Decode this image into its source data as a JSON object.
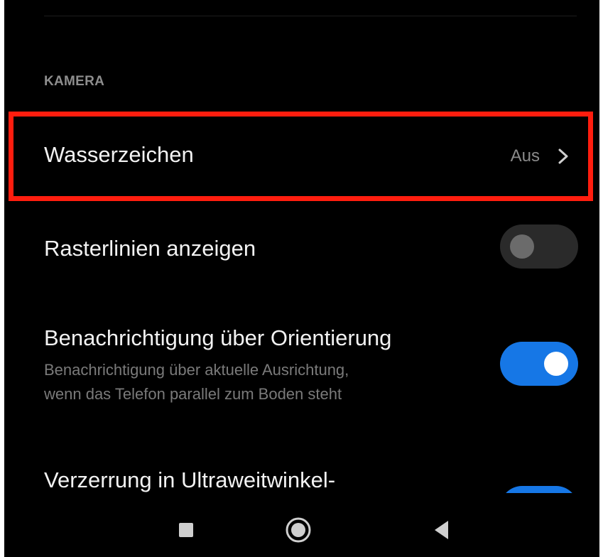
{
  "section": {
    "title": "KAMERA"
  },
  "settings": {
    "watermark": {
      "title": "Wasserzeichen",
      "value": "Aus"
    },
    "gridlines": {
      "title": "Rasterlinien anzeigen",
      "enabled": false
    },
    "orientation": {
      "title": "Benachrichtigung über Orientierung",
      "description_line1": "Benachrichtigung über aktuelle Ausrichtung,",
      "description_line2": "wenn das Telefon parallel zum Boden steht",
      "enabled": true
    },
    "distortion": {
      "title": "Verzerrung in Ultraweitwinkel-",
      "enabled": true
    }
  },
  "colors": {
    "accent": "#1677e6",
    "highlight": "#ff1d0e",
    "background": "#000000"
  },
  "navigation": {
    "icons": [
      "recent-apps-icon",
      "home-icon",
      "back-icon"
    ]
  }
}
